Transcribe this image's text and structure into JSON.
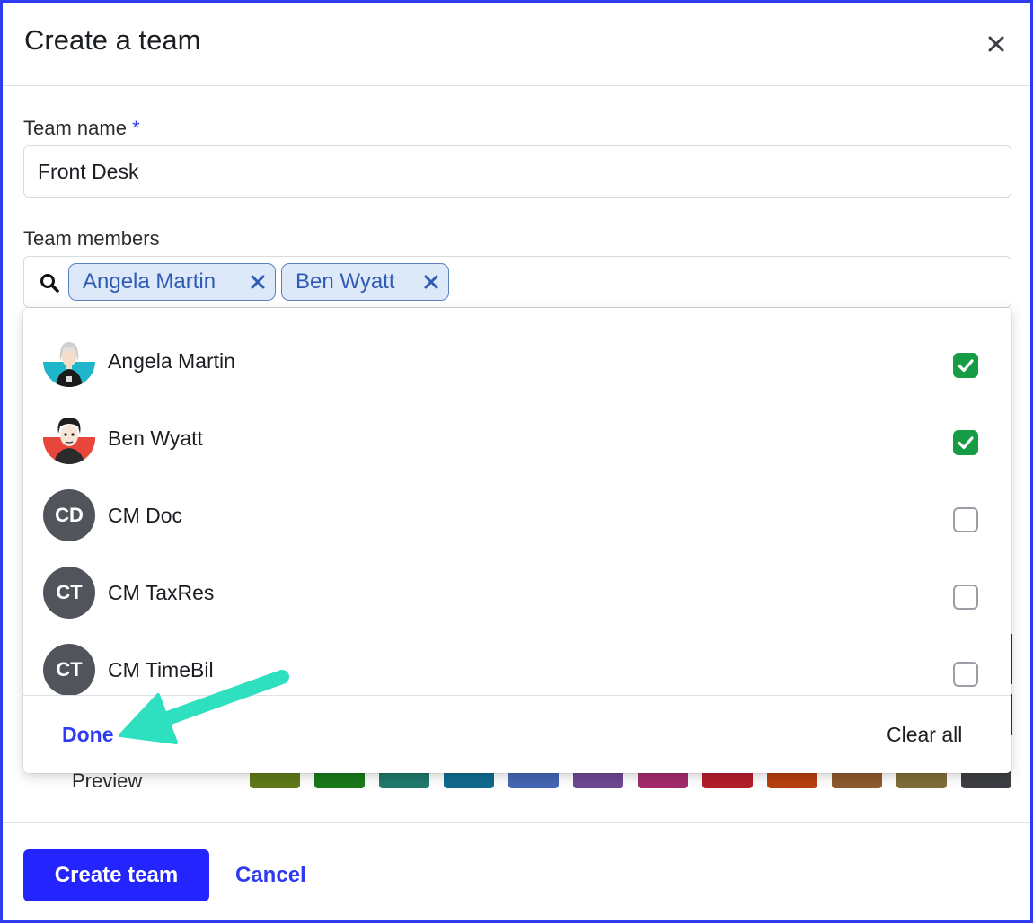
{
  "dialog": {
    "title": "Create a team",
    "close_icon": "close-icon"
  },
  "team_name": {
    "label": "Team name",
    "required_mark": "*",
    "value": "Front Desk"
  },
  "team_members": {
    "label": "Team members",
    "selected": [
      {
        "name": "Angela Martin"
      },
      {
        "name": "Ben Wyatt"
      }
    ]
  },
  "dropdown": {
    "options": [
      {
        "name": "Angela Martin",
        "avatar": "photo",
        "checked": true
      },
      {
        "name": "Ben Wyatt",
        "avatar": "photo",
        "checked": true
      },
      {
        "name": "CM Doc",
        "initials": "CD",
        "checked": false
      },
      {
        "name": "CM TaxRes",
        "initials": "CT",
        "checked": false
      },
      {
        "name": "CM TimeBil",
        "initials": "CT",
        "checked": false
      }
    ],
    "done_label": "Done",
    "clear_label": "Clear all"
  },
  "colors": {
    "preview_label": "Preview",
    "swatches": [
      "#5f7a19",
      "#1a7a1a",
      "#1f7a6c",
      "#0e6b8e",
      "#4466b5",
      "#6e4892",
      "#a32a6e",
      "#b31f2a",
      "#b8400f",
      "#8e5a2e",
      "#7e6e3a",
      "#3d3f44"
    ]
  },
  "footer": {
    "create_label": "Create team",
    "cancel_label": "Cancel"
  },
  "theme": {
    "accent": "#2f3bf0",
    "primary_button": "#2424ff",
    "check_green": "#169c45",
    "chip_bg": "#dde8f8",
    "annotation_arrow": "#2fe0c0"
  }
}
